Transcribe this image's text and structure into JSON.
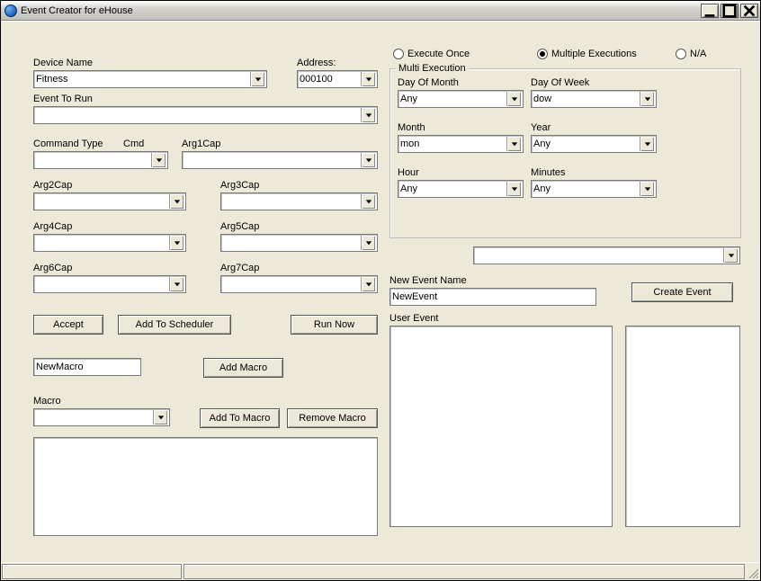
{
  "window": {
    "title": "Event Creator for eHouse"
  },
  "exec": {
    "once": "Execute Once",
    "multi": "Multiple Executions",
    "na": "N/A",
    "selected": "multi"
  },
  "labels": {
    "device_name": "Device Name",
    "address": "Address:",
    "event_to_run": "Event To Run",
    "command_type": "Command Type",
    "cmd": "Cmd",
    "arg1": "Arg1Cap",
    "arg2": "Arg2Cap",
    "arg3": "Arg3Cap",
    "arg4": "Arg4Cap",
    "arg5": "Arg5Cap",
    "arg6": "Arg6Cap",
    "arg7": "Arg7Cap",
    "macro": "Macro",
    "multi_exec": "Multi Execution",
    "day_of_month": "Day Of Month",
    "day_of_week": "Day Of Week",
    "month": "Month",
    "year": "Year",
    "hour": "Hour",
    "minutes": "Minutes",
    "new_event_name": "New Event Name",
    "user_event": "User Event"
  },
  "values": {
    "device_name": "Fitness",
    "address": "000100",
    "event_to_run": "",
    "command_type": "",
    "cmd": "",
    "arg1": "",
    "arg2": "",
    "arg3": "",
    "arg4": "",
    "arg5": "",
    "arg6": "",
    "arg7": "",
    "new_macro": "NewMacro",
    "macro": "",
    "day_of_month": "Any",
    "day_of_week": "dow",
    "month": "mon",
    "year": "Any",
    "hour": "Any",
    "minutes": "Any",
    "extra_combo": "",
    "new_event_name": "NewEvent"
  },
  "buttons": {
    "accept": "Accept",
    "add_to_scheduler": "Add To Scheduler",
    "run_now": "Run Now",
    "add_macro": "Add Macro",
    "add_to_macro": "Add To Macro",
    "remove_macro": "Remove Macro",
    "create_event": "Create Event"
  }
}
